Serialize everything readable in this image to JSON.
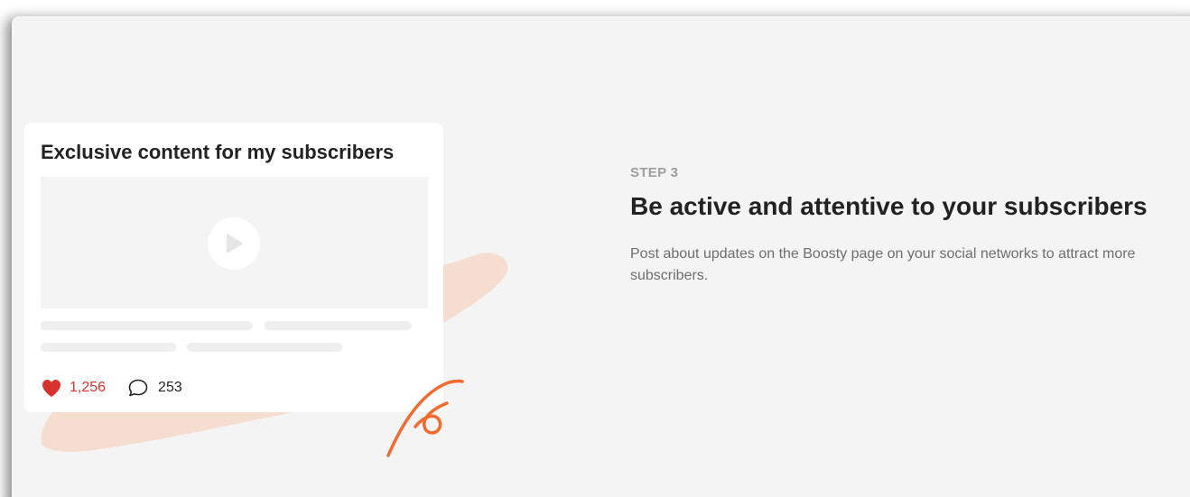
{
  "card": {
    "title": "Exclusive content for my subscribers",
    "likes": "1,256",
    "comments": "253",
    "icons": {
      "play": "play-icon",
      "like": "heart-icon",
      "comment": "comment-bubble-icon"
    }
  },
  "step": {
    "label": "STEP 3",
    "title": "Be active and attentive to your subscribers",
    "description": "Post about updates on the Boosty page on your social networks to attract more subscribers."
  },
  "colors": {
    "background": "#f4f4f4",
    "card": "#ffffff",
    "accent_like": "#d8322f",
    "brush_stroke": "#f5ddd0",
    "squiggle": "#f26a2e",
    "heading": "#222222",
    "muted": "#9e9e9e"
  }
}
